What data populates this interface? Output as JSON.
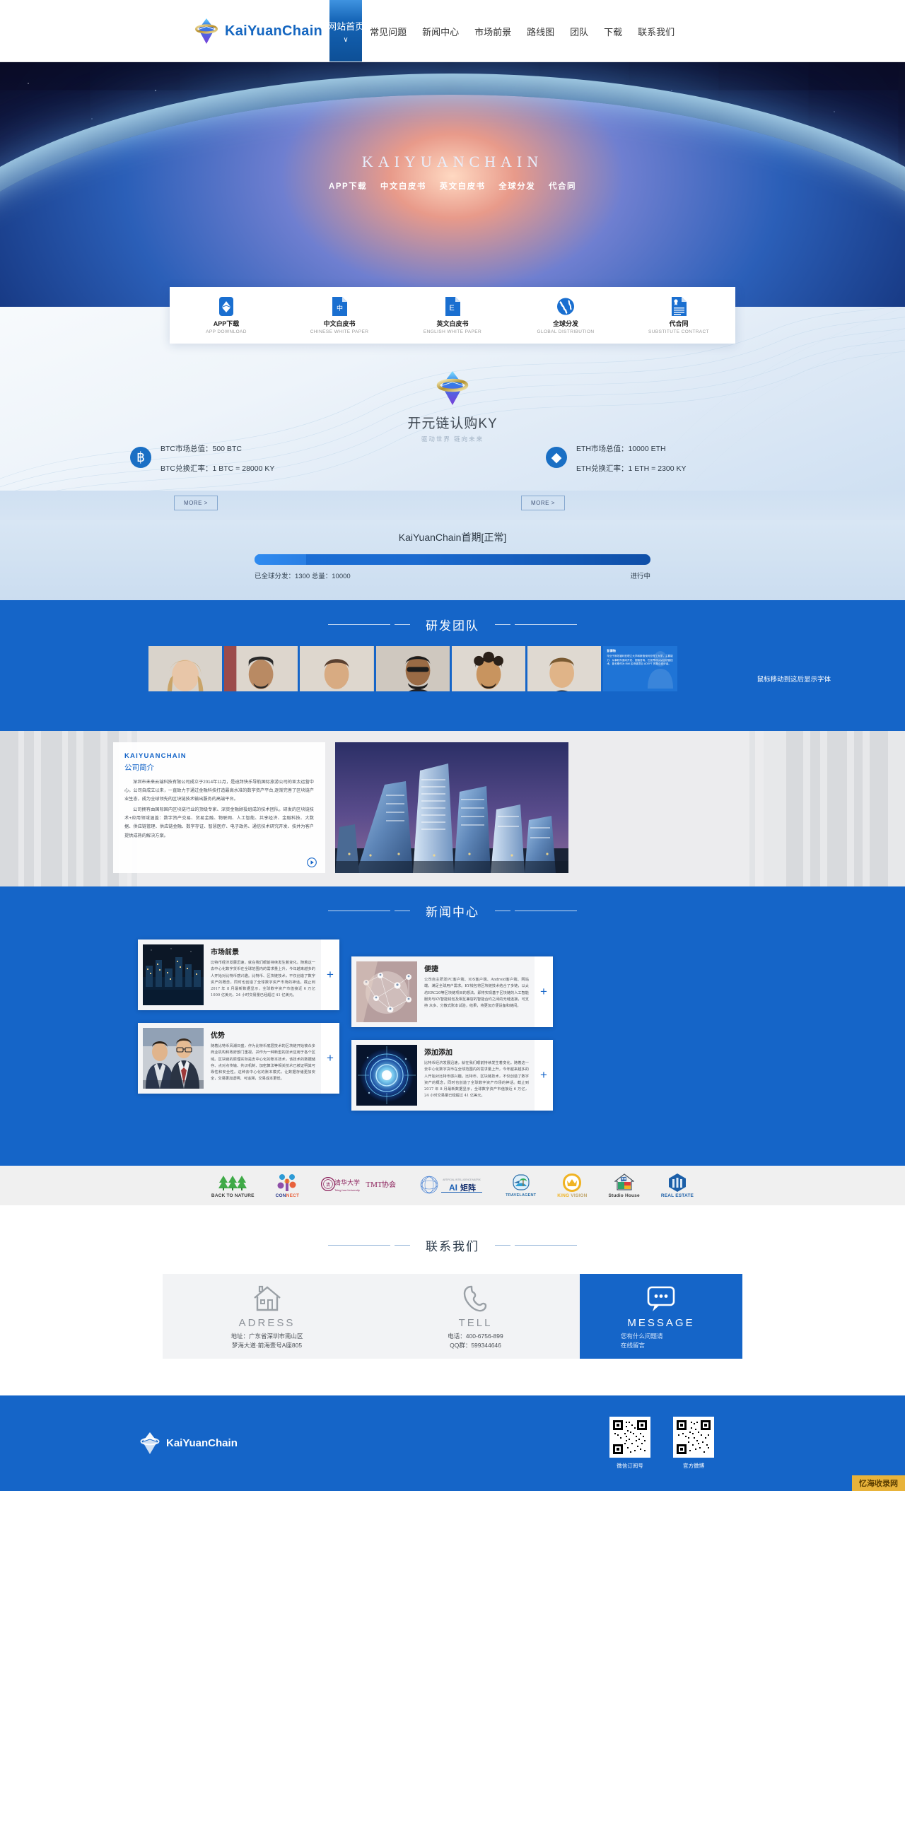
{
  "header": {
    "brand": "KaiYuanChain",
    "nav": [
      {
        "label": "网站首页",
        "active": true,
        "caret": "∨"
      },
      {
        "label": "常见问题",
        "active": false
      },
      {
        "label": "新闻中心",
        "active": false
      },
      {
        "label": "市场前景",
        "active": false
      },
      {
        "label": "路线图",
        "active": false
      },
      {
        "label": "团队",
        "active": false
      },
      {
        "label": "下载",
        "active": false
      },
      {
        "label": "联系我们",
        "active": false
      }
    ]
  },
  "hero": {
    "title": "KAIYUANCHAIN",
    "links": [
      "APP下载",
      "中文白皮书",
      "英文白皮书",
      "全球分发",
      "代合同"
    ]
  },
  "features": [
    {
      "icon": "app-download-icon",
      "cn": "APP下载",
      "en": "APP DOWNLOAD"
    },
    {
      "icon": "chinese-whitepaper-icon",
      "cn": "中文白皮书",
      "en": "CHINESE WHITE PAPER"
    },
    {
      "icon": "english-whitepaper-icon",
      "cn": "英文白皮书",
      "en": "ENGLISH WHITE PAPER"
    },
    {
      "icon": "globe-icon",
      "cn": "全球分发",
      "en": "GLOBAL DISTRIBUTION"
    },
    {
      "icon": "contract-icon",
      "cn": "代合同",
      "en": "SUBSTITUTE CONTRACT"
    }
  ],
  "ky": {
    "title": "开元链认购KY",
    "subtitle": "驱动世界 链向未来",
    "btc": {
      "symbol": "฿",
      "cap": "BTC市场总值：500 BTC",
      "rate": "BTC兑换汇率：1 BTC = 28000 KY",
      "more": "MORE >"
    },
    "eth": {
      "symbol": "◆",
      "cap": "ETH市场总值：10000 ETH",
      "rate": "ETH兑换汇率：1 ETH = 2300 KY",
      "more": "MORE >"
    }
  },
  "progress": {
    "title": "KaiYuanChain首期[正常]",
    "distributed_label": "已全球分发：1300 总量：10000",
    "status": "进行中",
    "percent": 13
  },
  "team": {
    "section_title": "研发团队",
    "hint": "鼠标移动到这后显示字体",
    "members": [
      {
        "name": "",
        "photo": "member-1"
      },
      {
        "name": "",
        "photo": "member-2"
      },
      {
        "name": "",
        "photo": "member-3"
      },
      {
        "name": "",
        "photo": "member-4"
      },
      {
        "name": "",
        "photo": "member-5"
      },
      {
        "name": "",
        "photo": "member-6"
      }
    ],
    "bio": {
      "name": "彭博物",
      "text": "毕业于斯坦福利亚理立大学和斯洛伐利亚理工大学，主要能力：从事软件面向开发、投融咨询，在投界可以从区块链技术，曾长期作为 IBM 区块链项目 ADEPT 的核心设计者。"
    }
  },
  "about": {
    "en_title": "KAIYUANCHAIN",
    "cn_title": "公司简介",
    "paragraphs": [
      "深圳市未来云端科技有限公司成立于2014年11月，是迪拜快乐导航国际旅游公司的亚太运营中心。公司自成立以来，一直致力于通过金融科技打造最高水准的数字资产平台,逐渐完善了区块链产业生态，成为全球领先的区块链技术输出服务的高端平台。",
      "公司拥有由国际国内区块链行业的顶级专家、深资金融顾投组成的技术团队。研发的区块链技术+应用领域涵盖：数字资产交易、贸易金融、物联网、人工智能、共享经济、金融科技、大数据、供应链管理、供应链金融、数字存证、智慧医疗、电子政务、通信技术研究开发、技并为客户提供成熟的解决方案。"
    ],
    "play_icon": "play-icon"
  },
  "news": {
    "section_title": "新闻中心",
    "plus_label": "+",
    "cards": [
      {
        "title": "市场前景",
        "text": "比特币经济发展迅速，就在我们眼前持续发生着变化。随着这一去中心化数字货币在全球范围内的需求量上升，今年越来越多的人开始对比特币感兴趣。比特币、区块链技术，不仅创造了数字资产的概念，同时也创造了全球数字资产市场的神话。截止到 2017 年 8 月最新数据显示，全球数字资产市值接近 6 万亿 1000 亿美元，24 小时交易量已经超过 41 亿美元。",
        "image": "city-night"
      },
      {
        "title": "便捷",
        "text": "公司自主研发PC客户端、IOS客户端、Android客户端、网站端，满足全球用户需求。KY钱包将区块链技术结合了多链，以太坊ERC20等区块链项目的想法，即将实现基于区块链的人工智能服务与KY智能钱包及相互兼容的智能合约之间的无缝连接，可支持 众多、分散式账本试验，结果，将更加方便设备和链间。",
        "image": "network-globe"
      },
      {
        "title": "优势",
        "text": "随着比特币风潮日盛，作为比特币底层技术的区块链开始被众多商业机构和政府部门重视，并作为一种新型的技术应用于各个区域。区块链的原理实际是去中心化的账本技术，该技术的数据储存、点对点传输、共识机制、加密算法等相关技术已被证明其可靠性和安全性。这种去中心化的账本模式，让数据存储更加安全，交易更加透明、可追溯，交易成本更低。",
        "image": "business-people"
      },
      {
        "title": "添加添加",
        "text": "比特币经济发展迅速，就在我们眼前持续发生着变化。随着这一去中心化数字货币在全球范围内的需求量上升，今年越来越多的人开始对比特币感兴趣。比特币、区块链技术，不仅创造了数字资产的概念，同时也创造了全球数字资产市场的神话。截止到 2017 年 8 月最新数据显示，全球数字资产市值接近 6 万亿，24 小时交易量已经超过 41 亿美元。",
        "image": "blue-tech-circle"
      }
    ]
  },
  "partners": [
    {
      "name": "BACK TO NATURE",
      "icon": "tree-icon",
      "color": "#3faa47"
    },
    {
      "name": "CONNECT",
      "icon": "molecule-icon",
      "color": "#2e5fa3"
    },
    {
      "name": "Tsing hua University TMT协会",
      "icon": "tsinghua-icon",
      "color": "#8b1f5a"
    },
    {
      "name": "AI矩阵",
      "icon": "ai-matrix-icon",
      "color": "#1a5fb4"
    },
    {
      "name": "TRAVELAGENT",
      "icon": "palm-icon",
      "color": "#2b6fa8"
    },
    {
      "name": "KING VISION",
      "icon": "crown-icon",
      "color": "#f0b323"
    },
    {
      "name": "Studio House",
      "icon": "house-icon",
      "color": "#3a6fb0"
    },
    {
      "name": "REAL ESTATE",
      "icon": "building-icon",
      "color": "#1c5fa8"
    }
  ],
  "contact": {
    "section_title": "联系我们",
    "address": {
      "icon": "home-icon",
      "title": "ADRESS",
      "lines": [
        "地址：广东省深圳市南山区",
        "梦海大道·前海壹号A座805"
      ]
    },
    "tel": {
      "icon": "phone-icon",
      "title": "TELL",
      "lines": [
        "电话：400-6756-899",
        "QQ群：599344646"
      ]
    },
    "message": {
      "icon": "chat-icon",
      "title": "MESSAGE",
      "lines": [
        "您有什么问题请",
        "在线留言"
      ]
    }
  },
  "footer": {
    "brand": "KaiYuanChain",
    "qrs": [
      {
        "caption": "微信订阅号"
      },
      {
        "caption": "官方微博"
      }
    ],
    "watermark": "忆海收录网"
  }
}
